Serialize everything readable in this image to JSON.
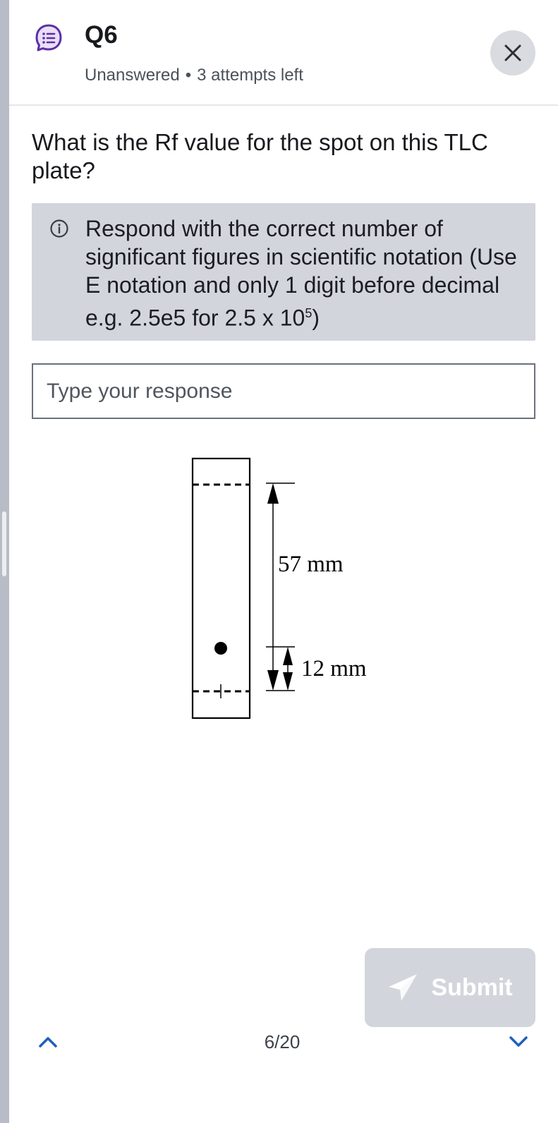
{
  "header": {
    "title": "Q6",
    "status": "Unanswered",
    "separator": "•",
    "attempts": "3 attempts left",
    "icon": "question-list-icon",
    "close_icon": "close-icon"
  },
  "question": {
    "text": "What is the Rf value for the spot on this TLC plate?"
  },
  "hint": {
    "icon": "info-icon",
    "text_main": "Respond with the correct number of significant figures in scientific notation (Use E notation and only 1 digit before decimal e.g. 2.5e5 for 2.5 x 10",
    "text_sup": "5",
    "text_end": ")"
  },
  "response": {
    "placeholder": "Type your response",
    "value": ""
  },
  "figure": {
    "solvent_distance_label": "57 mm",
    "spot_distance_label": "12 mm"
  },
  "footer": {
    "submit_label": "Submit",
    "submit_icon": "send-icon",
    "page_counter": "6/20",
    "prev_icon": "chevron-up-icon",
    "next_icon": "chevron-down-icon"
  },
  "colors": {
    "accent_purple": "#5b2ea6",
    "nav_blue": "#1f5fbf",
    "hint_background": "#d2d5dc",
    "submit_disabled": "#d2d5dc"
  }
}
